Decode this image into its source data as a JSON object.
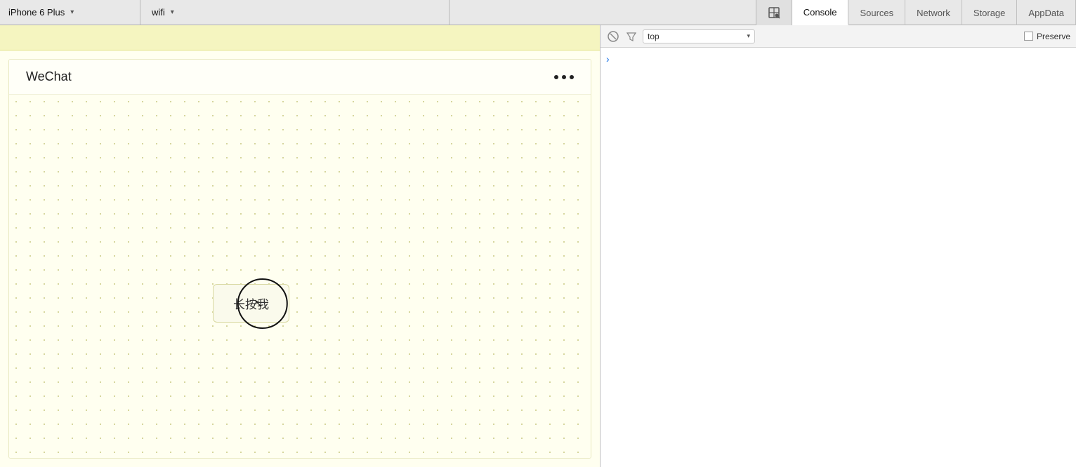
{
  "toolbar": {
    "device": "iPhone 6 Plus",
    "network": "wifi",
    "inspector_icon": "▣"
  },
  "devtools": {
    "tabs": [
      {
        "id": "console",
        "label": "Console",
        "active": true
      },
      {
        "id": "sources",
        "label": "Sources",
        "active": false
      },
      {
        "id": "network",
        "label": "Network",
        "active": false
      },
      {
        "id": "storage",
        "label": "Storage",
        "active": false
      },
      {
        "id": "appdata",
        "label": "AppData",
        "active": false
      }
    ]
  },
  "console": {
    "clear_button": "🚫",
    "filter_icon": "⛛",
    "filter_value": "top",
    "dropdown_arrow": "▾",
    "preserve_label": "Preserve",
    "arrow": "›"
  },
  "simulator": {
    "app_title": "WeChat",
    "dots": [
      "•",
      "•",
      "•"
    ],
    "longpress_text": "长按我",
    "status_bar": ""
  }
}
